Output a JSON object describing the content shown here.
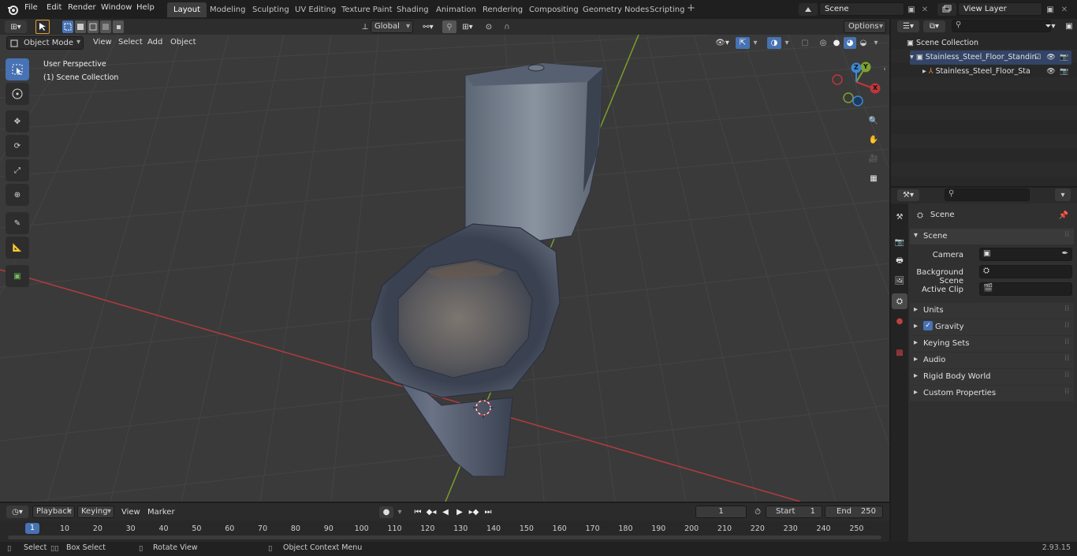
{
  "topbar": {
    "menus": [
      "File",
      "Edit",
      "Render",
      "Window",
      "Help"
    ],
    "workspace_tabs": [
      "Layout",
      "Modeling",
      "Sculpting",
      "UV Editing",
      "Texture Paint",
      "Shading",
      "Animation",
      "Rendering",
      "Compositing",
      "Geometry Nodes",
      "Scripting"
    ],
    "active_tab": "Layout",
    "add_tab": "+",
    "scene_name": "Scene",
    "view_layer": "View Layer"
  },
  "viewport_header": {
    "mode": "Object Mode",
    "menus": [
      "View",
      "Select",
      "Add",
      "Object"
    ],
    "orientation": "Global",
    "options": "Options"
  },
  "viewport": {
    "perspective": "User Perspective",
    "collection": "(1) Scene Collection",
    "gizmo_axes": [
      "Z",
      "Y",
      "X"
    ]
  },
  "outliner": {
    "root": "Scene Collection",
    "items": [
      {
        "label": "Stainless_Steel_Floor_Standin"
      },
      {
        "label": "Stainless_Steel_Floor_Sta"
      }
    ]
  },
  "properties": {
    "context": "Scene",
    "panel": "Scene",
    "fields": [
      {
        "label": "Camera"
      },
      {
        "label": "Background Scene"
      },
      {
        "label": "Active Clip"
      }
    ],
    "sections": [
      "Units",
      "Gravity",
      "Keying Sets",
      "Audio",
      "Rigid Body World",
      "Custom Properties"
    ]
  },
  "timeline": {
    "menus": [
      "Playback",
      "Keying",
      "View",
      "Marker"
    ],
    "current_frame": "1",
    "start_label": "Start",
    "start": "1",
    "end_label": "End",
    "end": "250",
    "ticks": [
      "1",
      "10",
      "20",
      "30",
      "40",
      "50",
      "60",
      "70",
      "80",
      "90",
      "100",
      "110",
      "120",
      "130",
      "140",
      "150",
      "160",
      "170",
      "180",
      "190",
      "200",
      "210",
      "220",
      "230",
      "240",
      "250"
    ]
  },
  "status": {
    "select": "Select",
    "box_select": "Box Select",
    "rotate_view": "Rotate View",
    "context_menu": "Object Context Menu",
    "version": "2.93.15"
  },
  "colors": {
    "accent": "#4772b3",
    "x_axis": "#c0363b",
    "y_axis": "#7fa32c",
    "z_axis": "#3d87d3"
  }
}
